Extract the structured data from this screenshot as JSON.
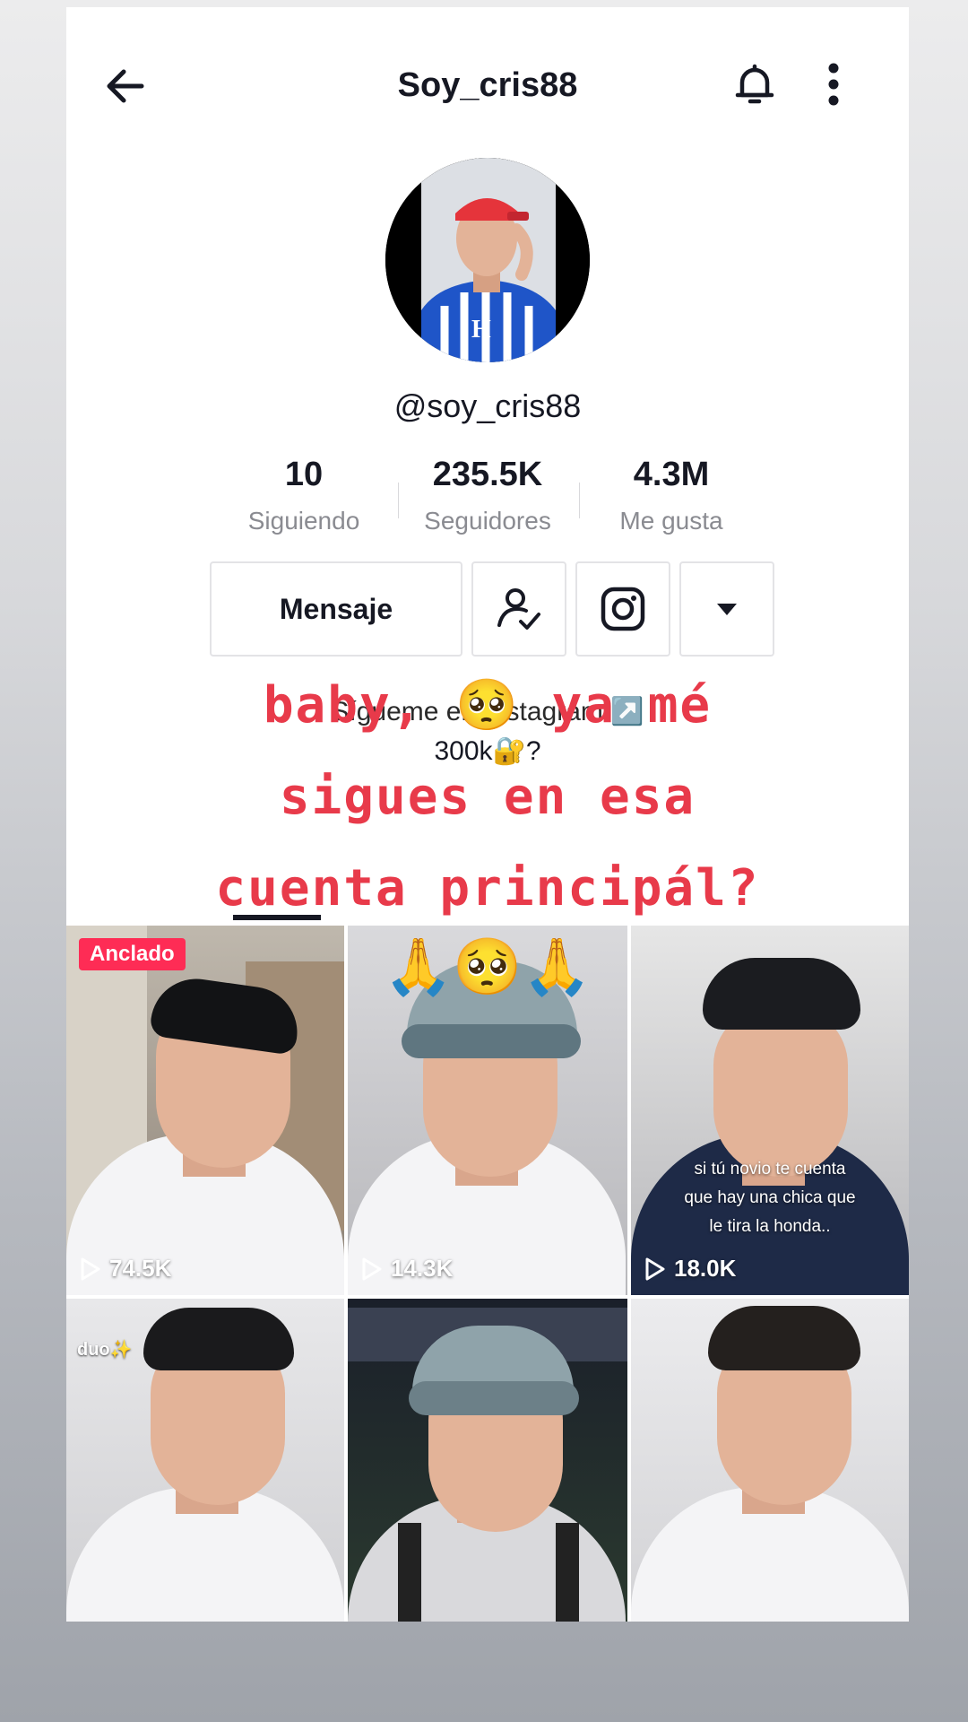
{
  "header": {
    "title": "Soy_cris88",
    "icons": [
      "back-arrow-icon",
      "bell-icon",
      "more-vertical-icon"
    ]
  },
  "profile": {
    "handle": "@soy_cris88",
    "stats": [
      {
        "value": "10",
        "label": "Siguiendo"
      },
      {
        "value": "235.5K",
        "label": "Seguidores"
      },
      {
        "value": "4.3M",
        "label": "Me gusta"
      }
    ]
  },
  "actions": {
    "message_label": "Mensaje",
    "icons": [
      "following-check-icon",
      "instagram-icon",
      "dropdown-triangle-icon"
    ]
  },
  "bio": {
    "line1": "Sígueme en Instagram ↗️",
    "line2": "300k🔐?"
  },
  "overlay_text": {
    "line1": "baby, 🥺 ya mé",
    "line2": "sigues en esa",
    "line3": "cuenta principál?"
  },
  "videos": [
    {
      "views": "74.5K",
      "pinned_label": "Anclado"
    },
    {
      "views": "14.3K",
      "emoji": "🙏🥺🙏"
    },
    {
      "views": "18.0K",
      "caption": [
        "si tú novio te cuenta",
        "que hay una chica que",
        "le tira la honda.."
      ]
    },
    {
      "views": "",
      "caption_tag": "duo✨"
    },
    {
      "views": ""
    },
    {
      "views": ""
    }
  ],
  "colors": {
    "accent": "#fe2c55",
    "overlay_text": "#e83a4a",
    "text_primary": "#161823",
    "text_secondary": "#8a8b91"
  }
}
